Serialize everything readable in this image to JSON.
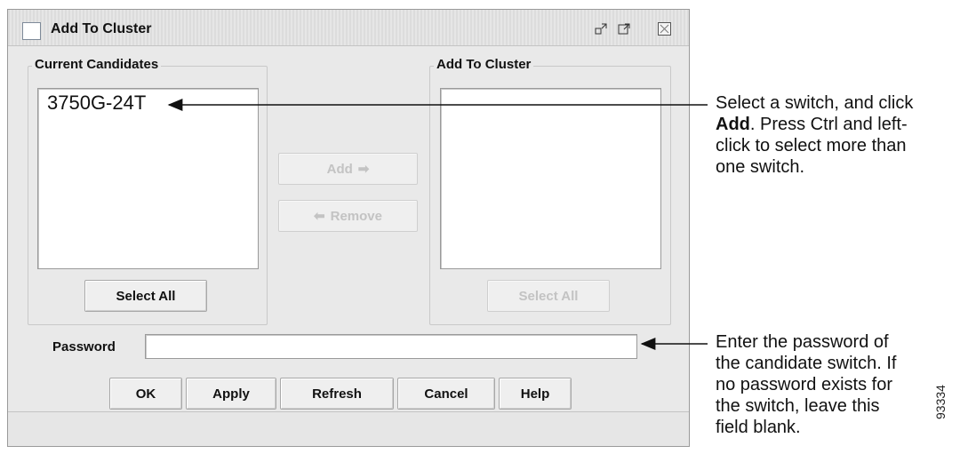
{
  "window": {
    "title": "Add To Cluster",
    "icons": [
      "window-icon",
      "restore-icon",
      "maximize-icon",
      "close-icon"
    ]
  },
  "candidates": {
    "label": "Current Candidates",
    "items": [
      "3750G-24T"
    ],
    "select_all_label": "Select All"
  },
  "actions": {
    "add_label": "Add",
    "remove_label": "Remove"
  },
  "cluster": {
    "label": "Add To Cluster",
    "items": [],
    "select_all_label": "Select All"
  },
  "password": {
    "label": "Password",
    "value": ""
  },
  "buttons": {
    "ok": "OK",
    "apply": "Apply",
    "refresh": "Refresh",
    "cancel": "Cancel",
    "help": "Help"
  },
  "annotations": {
    "select_line1_pre": "Select a switch, and click",
    "select_bold": "Add",
    "select_line2_post": ". Press Ctrl and left-",
    "select_line3": "click to select more than",
    "select_line4": "one switch.",
    "password_line1": "Enter the password of",
    "password_line2": "the candidate switch. If",
    "password_line3": "no password exists for",
    "password_line4": "the switch, leave this",
    "password_line5": "field blank."
  },
  "figure_id": "93334",
  "colors": {
    "window_bg": "#e9e9e9",
    "disabled_text": "#c3c3c3"
  }
}
